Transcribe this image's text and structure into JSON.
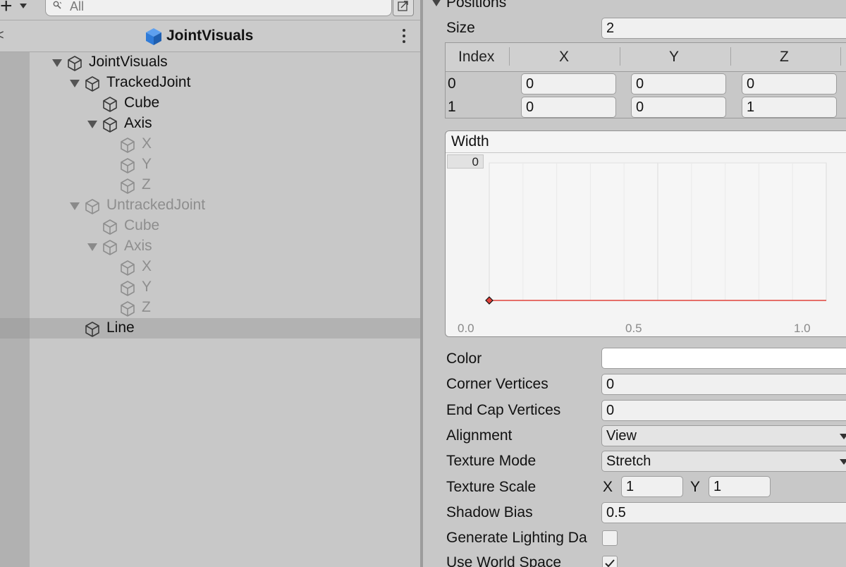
{
  "hierarchy": {
    "search_placeholder": "All",
    "scene_title": "JointVisuals",
    "items": [
      {
        "label": "JointVisuals",
        "depth": 0,
        "expanded": true,
        "dim": false
      },
      {
        "label": "TrackedJoint",
        "depth": 1,
        "expanded": true,
        "dim": false
      },
      {
        "label": "Cube",
        "depth": 2,
        "expanded": null,
        "dim": false
      },
      {
        "label": "Axis",
        "depth": 2,
        "expanded": true,
        "dim": false
      },
      {
        "label": "X",
        "depth": 3,
        "expanded": null,
        "dim": true
      },
      {
        "label": "Y",
        "depth": 3,
        "expanded": null,
        "dim": true
      },
      {
        "label": "Z",
        "depth": 3,
        "expanded": null,
        "dim": true
      },
      {
        "label": "UntrackedJoint",
        "depth": 1,
        "expanded": true,
        "dim": true
      },
      {
        "label": "Cube",
        "depth": 2,
        "expanded": null,
        "dim": true
      },
      {
        "label": "Axis",
        "depth": 2,
        "expanded": true,
        "dim": true
      },
      {
        "label": "X",
        "depth": 3,
        "expanded": null,
        "dim": true
      },
      {
        "label": "Y",
        "depth": 3,
        "expanded": null,
        "dim": true
      },
      {
        "label": "Z",
        "depth": 3,
        "expanded": null,
        "dim": true
      },
      {
        "label": "Line",
        "depth": 1,
        "expanded": null,
        "dim": false,
        "selected": true
      }
    ]
  },
  "inspector": {
    "positions_label": "Positions",
    "size_label": "Size",
    "size_value": "2",
    "table": {
      "headers": [
        "Index",
        "X",
        "Y",
        "Z"
      ],
      "rows": [
        {
          "index": "0",
          "x": "0",
          "y": "0",
          "z": "0"
        },
        {
          "index": "1",
          "x": "0",
          "y": "0",
          "z": "1"
        }
      ]
    },
    "width": {
      "label": "Width",
      "value": "0",
      "x_ticks": [
        "0.0",
        "0.5",
        "1.0"
      ],
      "curve_value": 0
    },
    "color_label": "Color",
    "color_value": "#ffffff",
    "corner_vertices_label": "Corner Vertices",
    "corner_vertices_value": "0",
    "end_cap_label": "End Cap Vertices",
    "end_cap_value": "0",
    "alignment_label": "Alignment",
    "alignment_value": "View",
    "texture_mode_label": "Texture Mode",
    "texture_mode_value": "Stretch",
    "texture_scale_label": "Texture Scale",
    "texture_scale_x_label": "X",
    "texture_scale_x": "1",
    "texture_scale_y_label": "Y",
    "texture_scale_y": "1",
    "shadow_bias_label": "Shadow Bias",
    "shadow_bias_value": "0.5",
    "generate_lighting_label": "Generate Lighting Da",
    "generate_lighting_checked": false,
    "use_world_space_label": "Use World Space",
    "use_world_space_checked": true
  },
  "colors": {
    "accent_cube": "#2f7bd8",
    "curve_line": "#e0413a",
    "panel_bg": "#c8c8c8"
  }
}
